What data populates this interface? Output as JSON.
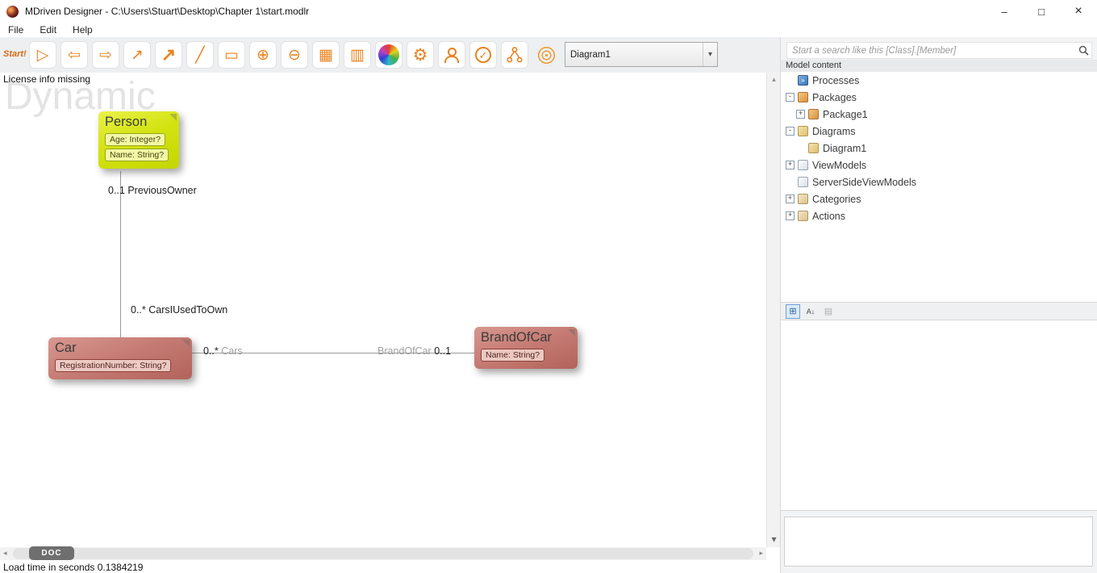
{
  "window": {
    "title": "MDriven Designer - C:\\Users\\Stuart\\Desktop\\Chapter 1\\start.modlr",
    "controls": {
      "minimize": "–",
      "maximize": "□",
      "close": "×"
    }
  },
  "menu": {
    "items": [
      "File",
      "Edit",
      "Help"
    ]
  },
  "toolbar": {
    "start_label": "Start!",
    "buttons": [
      {
        "name": "run-button",
        "glyph": "▷"
      },
      {
        "name": "nav-back-button",
        "glyph": "⇦"
      },
      {
        "name": "nav-forward-button",
        "glyph": "⇨"
      },
      {
        "name": "association-tool-button",
        "glyph": "↗"
      },
      {
        "name": "association-bold-tool-button",
        "glyph": "↗"
      },
      {
        "name": "line-tool-button",
        "glyph": "╱"
      },
      {
        "name": "select-tool-button",
        "glyph": "▭"
      },
      {
        "name": "zoom-in-button",
        "glyph": "⊕"
      },
      {
        "name": "zoom-out-button",
        "glyph": "⊖"
      },
      {
        "name": "grid-view-button",
        "glyph": "▦"
      },
      {
        "name": "diagram-report-button",
        "glyph": "▥"
      },
      {
        "name": "color-wheel-button",
        "glyph": ""
      },
      {
        "name": "settings-gears-button",
        "glyph": "⚙"
      },
      {
        "name": "user-settings-button",
        "glyph": ""
      },
      {
        "name": "validate-button",
        "glyph": "✓"
      },
      {
        "name": "hierarchy-button",
        "glyph": ""
      },
      {
        "name": "spiral-button",
        "glyph": ""
      }
    ],
    "diagram_selector_value": "Diagram1"
  },
  "search": {
    "placeholder": "Start a search like this [Class].[Member]"
  },
  "icons": {
    "dropdown_arrow": "▾",
    "scroll_up": "▴",
    "scroll_down": "▾",
    "scroll_left": "◂",
    "scroll_right": "▸",
    "processes_glyph": "»"
  },
  "canvas": {
    "license_text": "License info missing",
    "watermark": "Dynamic",
    "doc_tab_label": "DOC",
    "classes": [
      {
        "name": "Person",
        "attributes": [
          "Age: Integer?",
          "Name: String?"
        ]
      },
      {
        "name": "Car",
        "attributes": [
          "RegistrationNumber: String?"
        ]
      },
      {
        "name": "BrandOfCar",
        "attributes": [
          "Name: String?"
        ]
      }
    ],
    "associations": {
      "previous_owner_label": "0..1 PreviousOwner",
      "cars_i_used_label": "0..* CarsIUsedToOwn",
      "cars_multiplicity": "0..*",
      "cars_role": "Cars",
      "brand_role": "BrandOfCar",
      "brand_multiplicity": "0..1"
    }
  },
  "sidebar": {
    "model_content_label": "Model content",
    "tree": [
      {
        "label": "Processes",
        "expander": ""
      },
      {
        "label": "Packages",
        "expander": "-"
      },
      {
        "label": "Package1",
        "expander": "+"
      },
      {
        "label": "Diagrams",
        "expander": "-"
      },
      {
        "label": "Diagram1",
        "expander": ""
      },
      {
        "label": "ViewModels",
        "expander": "+"
      },
      {
        "label": "ServerSideViewModels",
        "expander": ""
      },
      {
        "label": "Categories",
        "expander": "+"
      },
      {
        "label": "Actions",
        "expander": "+"
      }
    ],
    "prop_toolbar": {
      "categorized_glyph": "⊞",
      "alphabetical_glyph": "A↓",
      "pages_glyph": "▤"
    }
  },
  "statusbar": {
    "load_time_text": "Load time in seconds 0.1384219"
  }
}
